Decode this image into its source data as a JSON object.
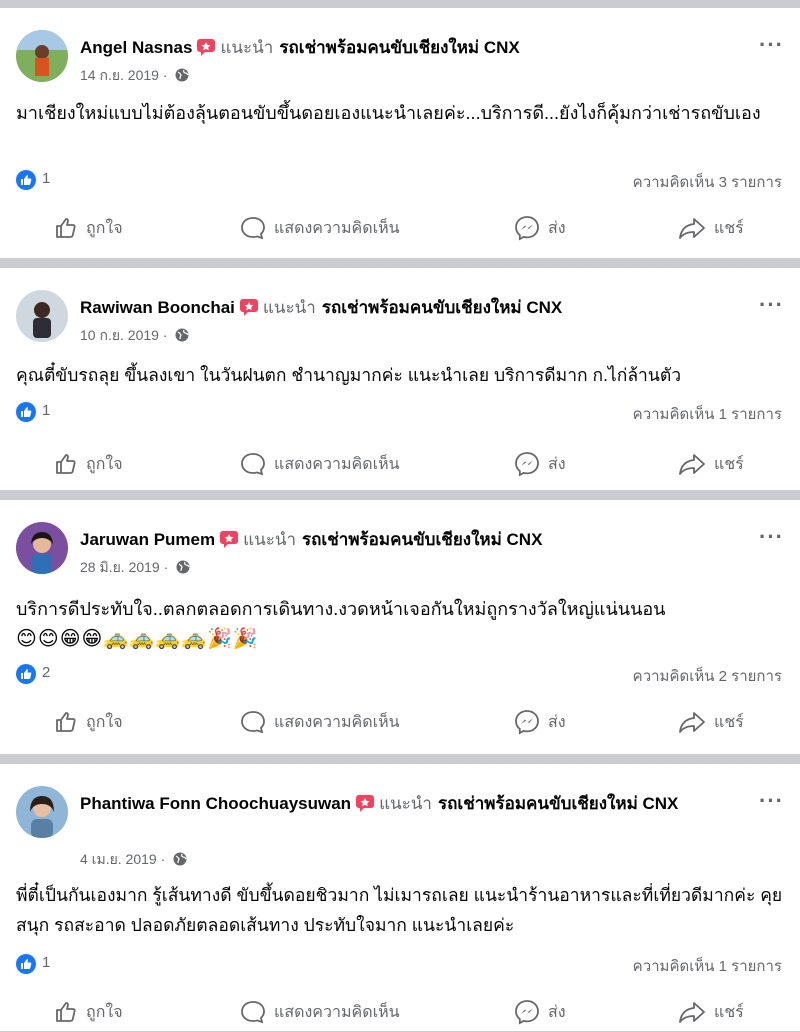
{
  "posts": [
    {
      "author": "Angel Nasnas",
      "recommend_label": "แนะนำ",
      "page_name": "รถเช่าพร้อมคนขับเชียงใหม่ CNX",
      "date": "14 ก.ย. 2019 ·",
      "text": "มาเชียงใหม่แบบไม่ต้องลุ้นตอนขับขึ้นดอยเองแนะนำเลยค่ะ...บริการดี...ยังไงก็คุ้มกว่าเช่ารถขับเอง",
      "emojis": "",
      "likes": "1",
      "comments": "ความคิดเห็น 3 รายการ"
    },
    {
      "author": "Rawiwan Boonchai",
      "recommend_label": "แนะนำ",
      "page_name": "รถเช่าพร้อมคนขับเชียงใหม่ CNX",
      "date": "10 ก.ย. 2019 ·",
      "text": "คุณตี๋ขับรถลุย ขึ้นลงเขา ในวันฝนตก ชำนาญมากค่ะ  แนะนำเลย บริการดีมาก ก.ไก่ล้านตัว",
      "emojis": "",
      "likes": "1",
      "comments": "ความคิดเห็น 1 รายการ"
    },
    {
      "author": "Jaruwan Pumem",
      "recommend_label": "แนะนำ",
      "page_name": "รถเช่าพร้อมคนขับเชียงใหม่ CNX",
      "date": "28 มิ.ย. 2019 ·",
      "text": "บริการดีประทับใจ..ตลกตลอดการเดินทาง.งวดหน้าเจอกันใหม่ถูกรางวัลใหญ่แน่นนอน",
      "emojis": "😊😊😁😁🚕🚕🚕🚕🎉🎉",
      "likes": "2",
      "comments": "ความคิดเห็น 2 รายการ"
    },
    {
      "author": "Phantiwa Fonn Choochuaysuwan",
      "recommend_label": "แนะนำ",
      "page_name": "รถเช่าพร้อมคนขับเชียงใหม่ CNX",
      "date": "4 เม.ย. 2019 ·",
      "text": "พี่ตี๋เป็นกันเองมาก รู้เส้นทางดี ขับขึ้นดอยชิวมาก ไม่เมารถเลย แนะนำร้านอาหารและที่เที่ยวดีมากค่ะ คุยสนุก รถสะอาด ปลอดภัยตลอดเส้นทาง ประทับใจมาก แนะนำเลยค่ะ",
      "emojis": "",
      "likes": "1",
      "comments": "ความคิดเห็น 1 รายการ"
    }
  ],
  "actions": {
    "like": "ถูกใจ",
    "comment": "แสดงความคิดเห็น",
    "send": "ส่ง",
    "share": "แชร์"
  },
  "more_label": "···",
  "colors": {
    "like_blue": "#1877f2",
    "secondary_text": "#65676b",
    "recommend_red": "#f3425f",
    "separator": "#c9ccd1"
  },
  "icons": [
    "recommend-icon",
    "globe-icon",
    "more-icon",
    "like-icon",
    "comment-icon",
    "messenger-icon",
    "share-icon"
  ]
}
